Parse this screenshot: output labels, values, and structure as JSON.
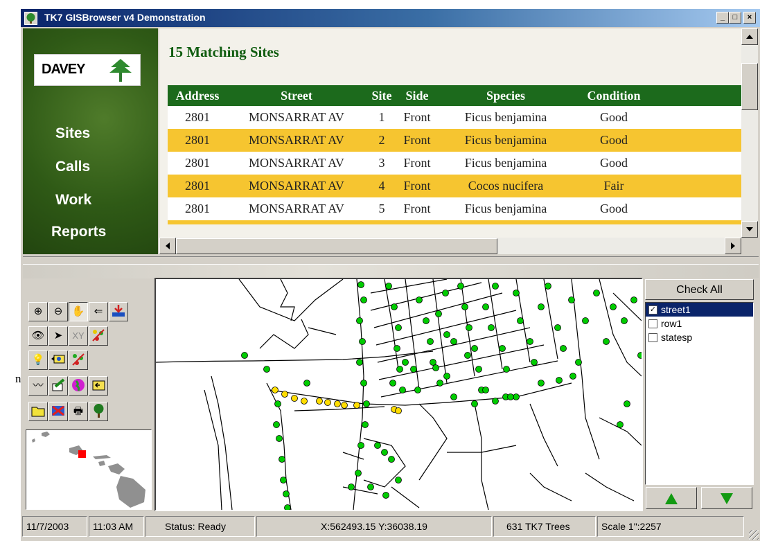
{
  "window": {
    "title": "TK7 GISBrowser  v4 Demonstration",
    "controls": [
      "minimize",
      "maximize",
      "close"
    ]
  },
  "outside_text": "n",
  "nav": {
    "logo_text": "DAVEY",
    "logo_icon": "tree-icon",
    "items": [
      {
        "label": "Sites"
      },
      {
        "label": "Calls"
      },
      {
        "label": "Work"
      },
      {
        "label": "Reports"
      }
    ]
  },
  "sites": {
    "heading": "15 Matching Sites",
    "columns": [
      "Address",
      "Street",
      "Site",
      "Side",
      "Species",
      "Condition"
    ],
    "rows": [
      [
        "2801",
        "MONSARRAT AV",
        "1",
        "Front",
        "Ficus benjamina",
        "Good"
      ],
      [
        "2801",
        "MONSARRAT AV",
        "2",
        "Front",
        "Ficus benjamina",
        "Good"
      ],
      [
        "2801",
        "MONSARRAT AV",
        "3",
        "Front",
        "Ficus benjamina",
        "Good"
      ],
      [
        "2801",
        "MONSARRAT AV",
        "4",
        "Front",
        "Cocos nucifera",
        "Fair"
      ],
      [
        "2801",
        "MONSARRAT AV",
        "5",
        "Front",
        "Ficus benjamina",
        "Good"
      ]
    ],
    "colors": {
      "header": "#1c6a1c",
      "alt_row": "#f6c530",
      "heading": "#0f5c0f"
    }
  },
  "toolbox": {
    "tools": [
      [
        "zoom-in-icon",
        "zoom-out-icon",
        "pan-hand-icon",
        "back-arrow-icon",
        "save-map-icon"
      ],
      [
        "eye-icon",
        "select-arrow-icon",
        "xy-coordinate-icon",
        "tree-points-icon"
      ],
      [
        "light-bulb-icon",
        "find-label-icon",
        "tree-points-alt-icon"
      ],
      [
        "profile-icon",
        "edit-icon",
        "globe-icon",
        "label-icon"
      ],
      [
        "open-folder-icon",
        "remove-icon",
        "print-icon",
        "tree-icon"
      ]
    ],
    "xy_label": "XY"
  },
  "layers": {
    "check_all_label": "Check All",
    "items": [
      {
        "name": "street1",
        "checked": true,
        "selected": true
      },
      {
        "name": "row1",
        "checked": false,
        "selected": false
      },
      {
        "name": "statesp",
        "checked": false,
        "selected": false
      }
    ],
    "check_mark": "✓",
    "arrows": [
      "up-arrow-icon",
      "down-arrow-icon"
    ]
  },
  "map": {
    "point_colors": {
      "trees": "#00cc00",
      "selected": "#ffdd00"
    }
  },
  "status": {
    "date": "11/7/2003",
    "time": "11:03 AM",
    "status_text": "Status: Ready",
    "coords": "X:562493.15 Y:36038.19",
    "count": "631  TK7 Trees",
    "scale": "Scale 1\":2257"
  }
}
